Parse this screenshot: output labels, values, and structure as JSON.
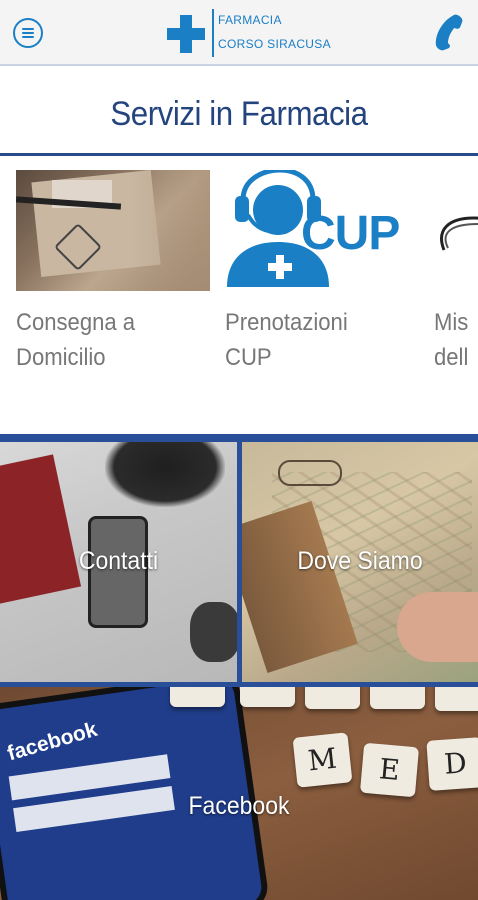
{
  "header": {
    "menu_icon": "hamburger-circle-icon",
    "logo_line1": "FARMACIA",
    "logo_line2": "CORSO SIRACUSA",
    "phone_icon": "phone-icon",
    "accent_color": "#1a7fc4"
  },
  "section": {
    "title": "Servizi in Farmacia",
    "title_color": "#24447e"
  },
  "services": [
    {
      "label_line1": "Consegna a",
      "label_line2": "Domicilio",
      "image": "delivery-photo"
    },
    {
      "label_line1": "Prenotazioni",
      "label_line2": "CUP",
      "image": "cup-logo",
      "logo_text": "CUP"
    },
    {
      "label_line1": "Mis",
      "label_line2": "dell",
      "image": "stethoscope-photo"
    }
  ],
  "tiles": {
    "contatti": "Contatti",
    "dove_siamo": "Dove Siamo",
    "facebook": "Facebook",
    "facebook_screen_text": "facebook",
    "letters": [
      "M",
      "E",
      "D"
    ]
  }
}
